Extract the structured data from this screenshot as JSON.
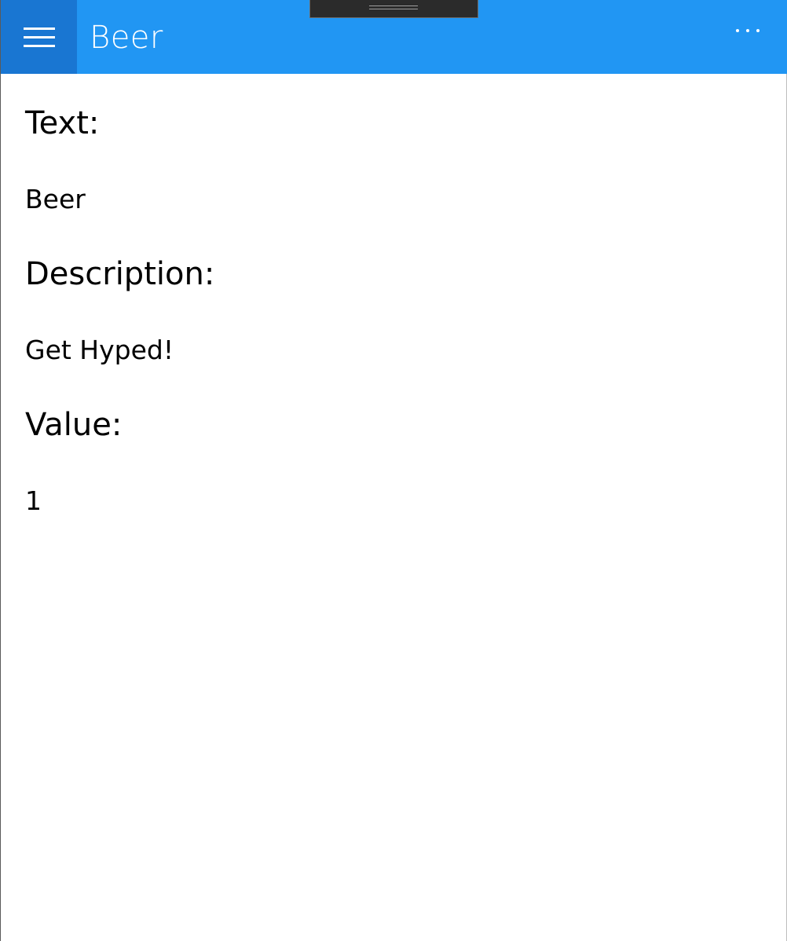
{
  "header": {
    "title": "Beer",
    "accent_color": "#2196f3",
    "menu_button_color": "#1976d2",
    "menu_icon": "hamburger-icon",
    "more_icon": "more-options-icon"
  },
  "details": {
    "text_label": "Text:",
    "text_value": "Beer",
    "description_label": "Description:",
    "description_value": "Get Hyped!",
    "value_label": "Value:",
    "value_value": "1"
  }
}
